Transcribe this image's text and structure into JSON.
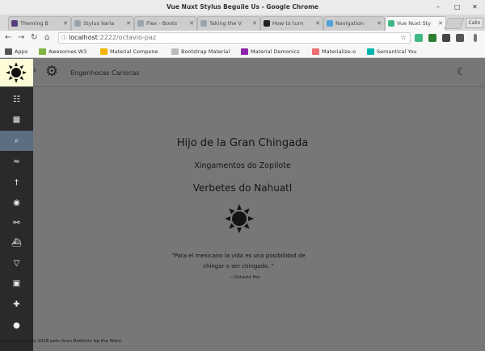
{
  "window": {
    "title": "Vue Nuxt Stylus Beguile Us - Google Chrome"
  },
  "tabs": [
    {
      "label": "Theming B",
      "color": "#563d7c"
    },
    {
      "label": "Stylus Varia",
      "color": "#9aa4ad"
    },
    {
      "label": "Flex - Boots",
      "color": "#9aa4ad"
    },
    {
      "label": "Taking the V",
      "color": "#9aa4ad"
    },
    {
      "label": "How to turn",
      "color": "#222222"
    },
    {
      "label": "Navigation",
      "color": "#4fa3d8"
    },
    {
      "label": "Vue Nuxt Sty",
      "color": "#41b883"
    }
  ],
  "profile": {
    "label": "Calin"
  },
  "address": {
    "host": "localhost",
    "rest": ":2222/octavio-paz"
  },
  "bookmarks": [
    {
      "label": "Apps",
      "color": "#555555"
    },
    {
      "label": "Awesomes W3",
      "color": "#7cb342"
    },
    {
      "label": "Material Compone",
      "color": "#f4b400"
    },
    {
      "label": "Bootstrap Material",
      "color": "#bbbbbb"
    },
    {
      "label": "Material Demonics",
      "color": "#8e24aa"
    },
    {
      "label": "Materialize-o",
      "color": "#ee6e73"
    },
    {
      "label": "Semantical You",
      "color": "#00b5ad"
    }
  ],
  "app": {
    "title": "Engenhocas Cariocas"
  },
  "sidebar": [
    {
      "icon": "apps-icon",
      "glyph": "☷"
    },
    {
      "icon": "dashboard-icon",
      "glyph": "▦"
    },
    {
      "icon": "search-icon",
      "glyph": "⌕"
    },
    {
      "icon": "waves-icon",
      "glyph": "≈"
    },
    {
      "icon": "walk-icon",
      "glyph": "†"
    },
    {
      "icon": "place-icon",
      "glyph": "◉"
    },
    {
      "icon": "bike-icon",
      "glyph": "⚯"
    },
    {
      "icon": "boat-icon",
      "glyph": "⛴"
    },
    {
      "icon": "cocktail-icon",
      "glyph": "▽"
    },
    {
      "icon": "local-mall-icon",
      "glyph": "▣"
    },
    {
      "icon": "hospital-icon",
      "glyph": "✚"
    },
    {
      "icon": "location-pin-icon",
      "glyph": "●"
    }
  ],
  "content": {
    "heading1": "Hijo de la Gran Chingada",
    "heading2": "Xingamentos do Zopilote",
    "heading3": "Verbetes do Nahuatl",
    "quote": "\"Para el mexicano la vida es una posibilidad de chingar o ser chingado. \"",
    "author": "—Octavio Paz"
  },
  "footer": "ado na Samboja 2018 pelo Gran Bretónio Up the Warú"
}
